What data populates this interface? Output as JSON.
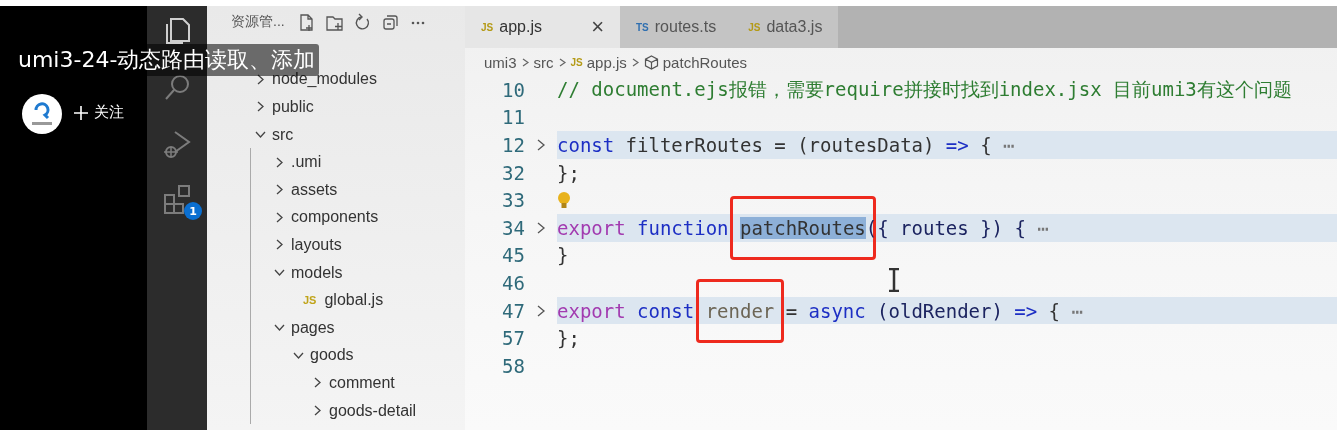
{
  "video_overlay": {
    "title": "umi3-24-动态路由读取、添加",
    "follow_button": "关注"
  },
  "activity_bar": {
    "items": [
      {
        "kind": "files",
        "selected": true
      },
      {
        "kind": "search",
        "selected": false
      },
      {
        "kind": "debug",
        "selected": false
      },
      {
        "kind": "extensions",
        "selected": false,
        "badge": "1"
      }
    ]
  },
  "explorer": {
    "title": "资源管...",
    "tree": [
      {
        "kind": "hidden"
      },
      {
        "kind": "folder",
        "name": "node_modules",
        "expanded": false
      },
      {
        "kind": "folder",
        "name": "public",
        "expanded": false
      },
      {
        "kind": "folder",
        "name": "src",
        "expanded": true,
        "children": [
          {
            "kind": "folder",
            "name": ".umi",
            "expanded": false
          },
          {
            "kind": "folder",
            "name": "assets",
            "expanded": false
          },
          {
            "kind": "folder",
            "name": "components",
            "expanded": false
          },
          {
            "kind": "folder",
            "name": "layouts",
            "expanded": false
          },
          {
            "kind": "folder",
            "name": "models",
            "expanded": true,
            "children": [
              {
                "kind": "file",
                "badge": "JS",
                "name": "global.js"
              }
            ]
          },
          {
            "kind": "folder",
            "name": "pages",
            "expanded": true,
            "children": [
              {
                "kind": "folder",
                "name": "goods",
                "expanded": true,
                "children": [
                  {
                    "kind": "folder",
                    "name": "comment",
                    "expanded": false
                  },
                  {
                    "kind": "folder",
                    "name": "goods-detail",
                    "expanded": false
                  }
                ]
              }
            ]
          }
        ]
      }
    ]
  },
  "tabs": [
    {
      "badge": "JS",
      "label": "app.js",
      "selected": true,
      "close": "×"
    },
    {
      "badge": "TS",
      "label": "routes.ts",
      "selected": false
    },
    {
      "badge": "JS",
      "label": "data3.js",
      "selected": false
    }
  ],
  "breadcrumb": [
    {
      "kind": "text",
      "label": "umi3"
    },
    {
      "kind": "text",
      "label": "src"
    },
    {
      "kind": "file",
      "badge": "JS",
      "label": "app.js"
    },
    {
      "kind": "symbol",
      "label": "patchRoutes"
    }
  ],
  "code_lines": [
    {
      "number": "10",
      "folded": false,
      "bulb": false,
      "tokens": [
        {
          "t": "// document.ejs报错，需要require拼接时找到index.jsx 目前umi3有这个问题",
          "kind": "comment",
          "selected": false,
          "boxed": false
        }
      ]
    },
    {
      "number": "11",
      "folded": false,
      "bulb": false
    },
    {
      "number": "12",
      "folded": true,
      "bulb": false,
      "tokens": [
        {
          "t": "const",
          "kind": "storage",
          "selected": false,
          "boxed": false
        },
        {
          "t": "filterRoutes = (routesData)",
          "kind": "plain",
          "selected": false,
          "boxed": false
        },
        {
          "t": "=>",
          "kind": "storage",
          "selected": false,
          "boxed": false
        },
        {
          "t": "{",
          "kind": "plain",
          "selected": false,
          "boxed": false
        },
        {
          "t": "⋯",
          "kind": "fold",
          "selected": false,
          "boxed": false
        }
      ]
    },
    {
      "number": "32",
      "folded": false,
      "bulb": false,
      "tokens": [
        {
          "t": "};",
          "kind": "plain",
          "selected": false,
          "boxed": false
        }
      ]
    },
    {
      "number": "33",
      "folded": false,
      "bulb": true
    },
    {
      "number": "34",
      "folded": true,
      "bulb": false,
      "tokens": [
        {
          "t": "export",
          "kind": "keyword",
          "selected": false,
          "boxed": false
        },
        {
          "t": "function",
          "kind": "storage",
          "selected": false,
          "boxed": false
        },
        {
          "t": "patchRoutes",
          "kind": "plain",
          "selected": true,
          "boxed": true
        },
        {
          "t": "({ routes }) {",
          "kind": "args",
          "selected": false,
          "boxed": false
        },
        {
          "t": "⋯",
          "kind": "fold",
          "selected": false,
          "boxed": false
        }
      ]
    },
    {
      "number": "45",
      "folded": false,
      "bulb": false,
      "tokens": [
        {
          "t": "}",
          "kind": "plain",
          "selected": false,
          "boxed": false
        }
      ]
    },
    {
      "number": "46",
      "folded": false,
      "bulb": false
    },
    {
      "number": "47",
      "folded": true,
      "bulb": false,
      "tokens": [
        {
          "t": "export",
          "kind": "keyword",
          "selected": false,
          "boxed": false
        },
        {
          "t": "const",
          "kind": "storage",
          "selected": false,
          "boxed": false
        },
        {
          "t": "render",
          "kind": "variable",
          "selected": false,
          "boxed": true
        },
        {
          "t": "=",
          "kind": "plain",
          "selected": false,
          "boxed": false
        },
        {
          "t": "async",
          "kind": "storage",
          "selected": false,
          "boxed": false
        },
        {
          "t": "(oldRender)",
          "kind": "param",
          "selected": false,
          "boxed": false
        },
        {
          "t": "=>",
          "kind": "storage",
          "selected": false,
          "boxed": false
        },
        {
          "t": "{",
          "kind": "plain",
          "selected": false,
          "boxed": false
        },
        {
          "t": "⋯",
          "kind": "fold",
          "selected": false,
          "boxed": false
        }
      ]
    },
    {
      "number": "57",
      "folded": false,
      "bulb": false,
      "tokens": [
        {
          "t": "};",
          "kind": "plain",
          "selected": false,
          "boxed": false
        }
      ]
    },
    {
      "number": "58",
      "folded": false,
      "bulb": false
    }
  ]
}
